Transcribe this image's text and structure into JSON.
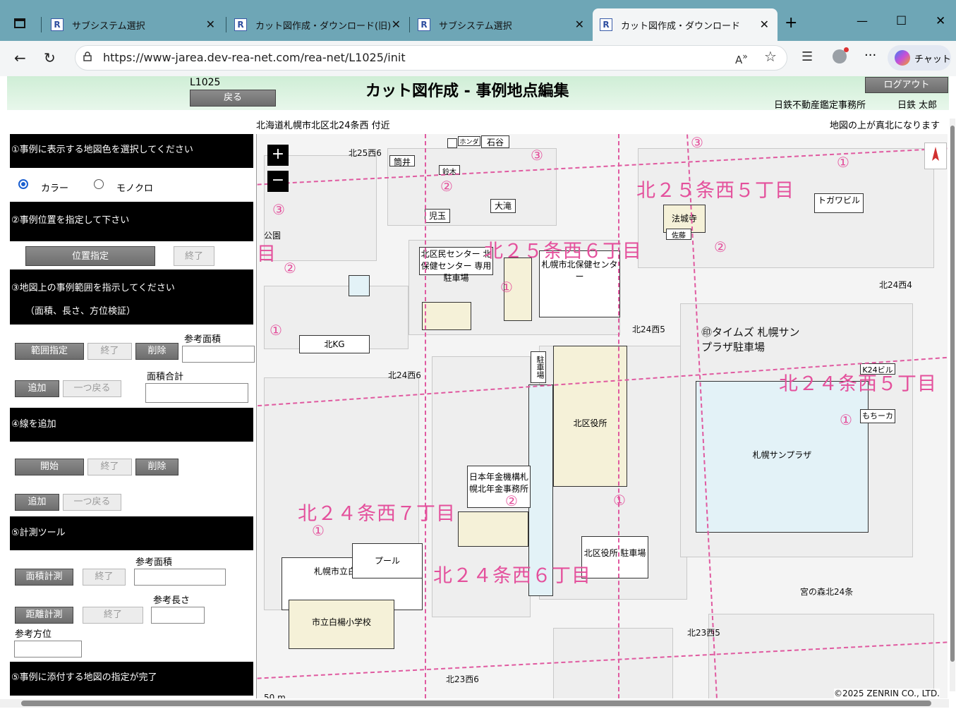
{
  "browser": {
    "tabs": [
      {
        "favicon": "R",
        "label": "サブシステム選択"
      },
      {
        "favicon": "R",
        "label": "カット図作成・ダウンロード(旧)"
      },
      {
        "favicon": "R",
        "label": "サブシステム選択"
      },
      {
        "favicon": "R",
        "label": "カット図作成・ダウンロード"
      }
    ],
    "new_tab": "+",
    "url": "https://www-jarea.dev-rea-net.com/rea-net/L1025/init",
    "chat_label": "チャット",
    "window_controls": {
      "minimize": "—",
      "maximize": "☐",
      "close": "✕"
    }
  },
  "header": {
    "screen_id": "L1025",
    "back_label": "戻る",
    "title": "カット図作成 - 事例地点編集",
    "logout_label": "ログアウト",
    "office": "日鉄不動産鑑定事務所",
    "user": "日鉄 太郎"
  },
  "location": {
    "address": "北海道札幌市北区北24条西 付近",
    "north_note": "地図の上が真北になります"
  },
  "panel": {
    "s1": {
      "title": "①事例に表示する地図色を選択してください",
      "opt_color": "カラー",
      "opt_mono": "モノクロ",
      "selected": "カラー"
    },
    "s2": {
      "title": "②事例位置を指定して下さい",
      "btn_set": "位置指定",
      "btn_end": "終了"
    },
    "s3": {
      "title": "③地図上の事例範囲を指示してください",
      "subtitle": "（面積、長さ、方位検証）",
      "btn_range": "範囲指定",
      "btn_end": "終了",
      "btn_delete": "削除",
      "ref_area_label": "参考面積",
      "btn_add": "追加",
      "btn_undo": "一つ戻る",
      "total_area_label": "面積合計"
    },
    "s4": {
      "title": "④線を追加",
      "btn_start": "開始",
      "btn_end": "終了",
      "btn_delete": "削除",
      "btn_add": "追加",
      "btn_undo": "一つ戻る"
    },
    "s5": {
      "title": "⑤計測ツール",
      "ref_area_label": "参考面積",
      "btn_area": "面積計測",
      "btn_end": "終了",
      "ref_length_label": "参考長さ",
      "btn_distance": "距離計測",
      "btn_end2": "終了",
      "ref_bearing_label": "参考方位"
    },
    "s6": {
      "title": "⑤事例に添付する地図の指定が完了"
    }
  },
  "map": {
    "zoom_in": "+",
    "zoom_out": "−",
    "scale": "50 m",
    "copyright": "©2025 ZENRIN CO., LTD.",
    "chome_labels": [
      "北２５条西５丁目",
      "北２５条西６丁目",
      "北２４条西５丁目",
      "北２４条西７丁目",
      "北２４条西６丁目",
      "目"
    ],
    "stops": [
      "北25西6",
      "北24西4",
      "北24西5",
      "北24西6",
      "北23西5",
      "北23西6"
    ],
    "places": [
      "北区民センター 北保健センター 専用駐車場",
      "札幌市北保健センター",
      "北KG",
      "北区役所",
      "北区役所 駐車場",
      "㊞タイムズ 札幌サンプラザ駐車場",
      "札幌サンプラザ",
      "日本年金機構札幌北年金事務所",
      "札幌市立白楊小学校",
      "市立白楊小学校",
      "プール",
      "法城寺",
      "駐車場",
      "公園",
      "宮の森北24条"
    ],
    "shops": [
      "筒井",
      "石谷",
      "児玉",
      "大滝",
      "佐藤",
      "トガワビル",
      "K24ビル",
      "もちーカ",
      "ホンダ",
      "鈴木"
    ],
    "circles": [
      "③",
      "②",
      "①",
      "③",
      "②",
      "②",
      "①",
      "①",
      "①",
      "①",
      "②",
      "①",
      "③",
      "①",
      "①"
    ]
  }
}
